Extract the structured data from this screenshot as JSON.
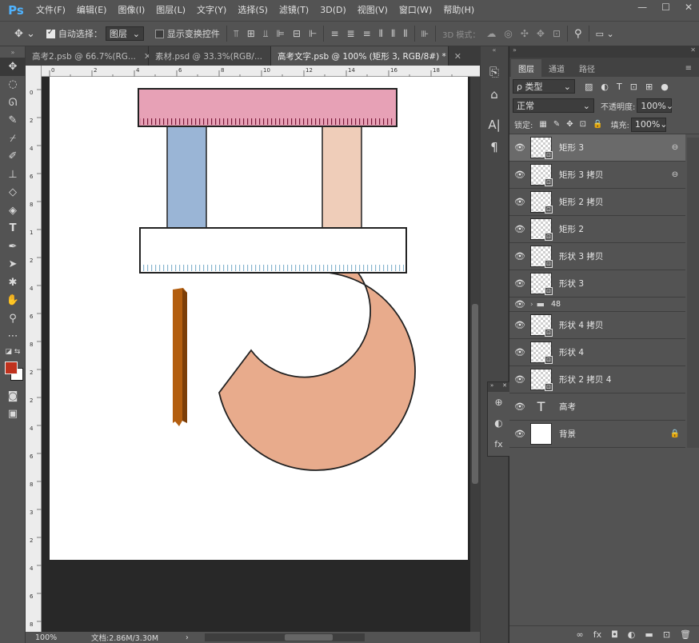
{
  "app": {
    "logo": "Ps"
  },
  "menu": [
    "文件(F)",
    "编辑(E)",
    "图像(I)",
    "图层(L)",
    "文字(Y)",
    "选择(S)",
    "滤镜(T)",
    "3D(D)",
    "视图(V)",
    "窗口(W)",
    "帮助(H)"
  ],
  "window_controls": [
    "—",
    "☐",
    "✕"
  ],
  "options": {
    "auto_select_label": "自动选择：",
    "auto_select_value": "图层",
    "show_transform_label": "显示变换控件",
    "mode3d_label": "3D 模式："
  },
  "tabs": [
    {
      "label": "高考2.psb @ 66.7%(RG...",
      "close": "✕"
    },
    {
      "label": "素材.psd @ 33.3%(RGB/...",
      "close": "✕"
    },
    {
      "label": "高考文字.psb @ 100% (矩形 3, RGB/8#) *",
      "close": "✕"
    }
  ],
  "ruler": {
    "h_ticks": [
      "0",
      "2",
      "4",
      "6",
      "8",
      "10",
      "12",
      "14",
      "16",
      "18"
    ],
    "v_ticks": [
      "0",
      "2",
      "4",
      "6",
      "8",
      "1",
      "2",
      "4",
      "6",
      "8",
      "2",
      "2",
      "4",
      "6",
      "8",
      "3",
      "2",
      "4",
      "6",
      "8"
    ]
  },
  "status": {
    "zoom": "100%",
    "doc": "文档:2.86M/3.30M",
    "arrow": "›"
  },
  "panel": {
    "tabs": [
      "图层",
      "通道",
      "路径"
    ],
    "filter_kind": "ρ 类型",
    "blend_mode": "正常",
    "opacity_label": "不透明度:",
    "opacity_value": "100%",
    "lock_label": "锁定:",
    "fill_label": "填充:",
    "fill_value": "100%",
    "layers": [
      {
        "name": "矩形 3",
        "kind": "shape",
        "badge": "⊖",
        "selected": true
      },
      {
        "name": "矩形 3 拷贝",
        "kind": "shape",
        "badge": "⊖"
      },
      {
        "name": "矩形 2 拷贝",
        "kind": "shape",
        "badge": ""
      },
      {
        "name": "矩形 2",
        "kind": "shape",
        "badge": ""
      },
      {
        "name": "形状 3 拷贝",
        "kind": "shape",
        "badge": ""
      },
      {
        "name": "形状 3",
        "kind": "shape",
        "badge": ""
      },
      {
        "name": "48",
        "kind": "group",
        "badge": ""
      },
      {
        "name": "形状 4 拷贝",
        "kind": "shape",
        "badge": ""
      },
      {
        "name": "形状 4",
        "kind": "shape",
        "badge": ""
      },
      {
        "name": "形状 2 拷贝 4",
        "kind": "shape",
        "badge": ""
      },
      {
        "name": "高考",
        "kind": "text",
        "badge": ""
      },
      {
        "name": "背景",
        "kind": "background",
        "badge": "🔒"
      }
    ],
    "footer_icons": [
      "∞",
      "fx",
      "◘",
      "◐",
      "▬",
      "⊡",
      "🗑"
    ]
  },
  "colors": {
    "pink_bar": "#e7a1b6",
    "blue_bar": "#9ab5d6",
    "peach_bar": "#efcdb9",
    "arc": "#e8ab8c",
    "pencil": "#b35e0f",
    "foreground": "#c0321e",
    "background": "#ffffff"
  }
}
